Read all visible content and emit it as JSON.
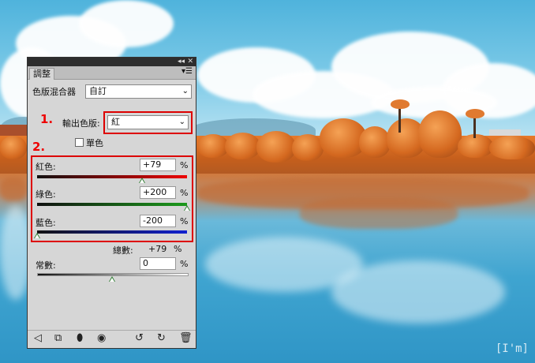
{
  "panel": {
    "tab_label": "調整",
    "collapse_glyph": "◂◂",
    "close_glyph": "✕",
    "menu_glyph": "▾☰",
    "adjustment_name": "色版混合器",
    "preset_value": "自訂",
    "output_channel_label": "輸出色版:",
    "output_channel_value": "紅",
    "monochrome_label": "單色",
    "monochrome_checked": false,
    "channels": [
      {
        "label": "紅色:",
        "value": "+79",
        "unit": "%",
        "level": 0.6975
      },
      {
        "label": "綠色:",
        "value": "+200",
        "unit": "%",
        "level": 1.0
      },
      {
        "label": "藍色:",
        "value": "-200",
        "unit": "%",
        "level": 0.0
      }
    ],
    "total_label": "總數:",
    "total_value": "+79",
    "total_unit": "%",
    "constant_label": "常數:",
    "constant_value": "0",
    "constant_unit": "%",
    "constant_level": 0.5,
    "bottom_icons": [
      "back-arrow-icon",
      "clip-layer-icon",
      "mask-icon",
      "visibility-eye-icon",
      "previous-state-icon",
      "reset-icon",
      "trash-icon"
    ]
  },
  "annotations": {
    "step1": "1.",
    "step2": "2."
  },
  "watermark": "[I'm]",
  "colors": {
    "annotation_red": "#dd0000",
    "panel_bg": "#d6d6d6",
    "thumb_green": "#2e7d32"
  }
}
